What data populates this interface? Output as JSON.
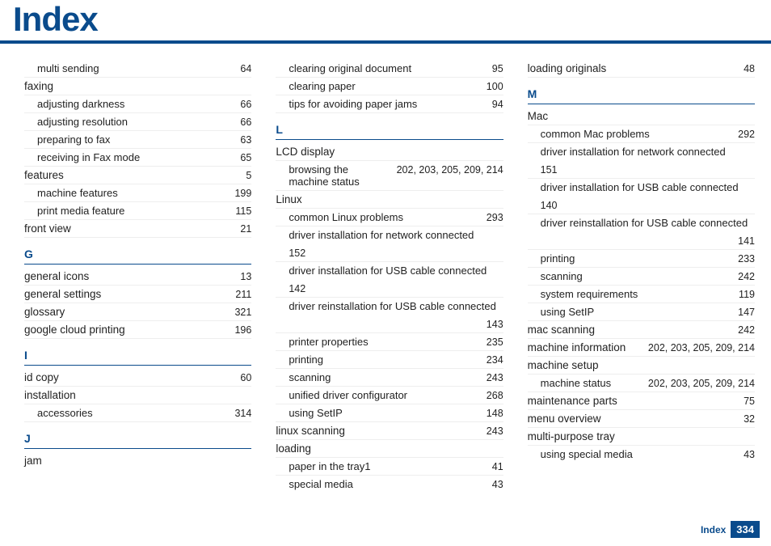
{
  "title": "Index",
  "footer": {
    "label": "Index",
    "page": "334"
  },
  "col1": [
    {
      "type": "sub",
      "label": "multi sending",
      "pages": "64"
    },
    {
      "type": "top",
      "label": "faxing",
      "pages": ""
    },
    {
      "type": "sub",
      "label": "adjusting darkness",
      "pages": "66"
    },
    {
      "type": "sub",
      "label": "adjusting resolution",
      "pages": "66"
    },
    {
      "type": "sub",
      "label": "preparing to fax",
      "pages": "63"
    },
    {
      "type": "sub",
      "label": "receiving in Fax mode",
      "pages": "65"
    },
    {
      "type": "top",
      "label": "features",
      "pages": "5"
    },
    {
      "type": "sub",
      "label": "machine features",
      "pages": "199"
    },
    {
      "type": "sub",
      "label": "print media feature",
      "pages": "115"
    },
    {
      "type": "top",
      "label": "front view",
      "pages": "21"
    },
    {
      "type": "letter",
      "label": "G"
    },
    {
      "type": "top",
      "label": "general icons",
      "pages": "13"
    },
    {
      "type": "top",
      "label": "general settings",
      "pages": "211"
    },
    {
      "type": "top",
      "label": "glossary",
      "pages": "321"
    },
    {
      "type": "top",
      "label": "google cloud printing",
      "pages": "196"
    },
    {
      "type": "letter",
      "label": "I"
    },
    {
      "type": "top",
      "label": "id copy",
      "pages": "60"
    },
    {
      "type": "top",
      "label": "installation",
      "pages": ""
    },
    {
      "type": "sub",
      "label": "accessories",
      "pages": "314"
    },
    {
      "type": "letter",
      "label": "J"
    },
    {
      "type": "top",
      "label": "jam",
      "pages": "",
      "noborder": true
    }
  ],
  "col2": [
    {
      "type": "sub",
      "label": "clearing original document",
      "pages": "95"
    },
    {
      "type": "sub",
      "label": "clearing paper",
      "pages": "100"
    },
    {
      "type": "sub",
      "label": "tips for avoiding paper jams",
      "pages": "94"
    },
    {
      "type": "letter",
      "label": "L"
    },
    {
      "type": "top",
      "label": "LCD display",
      "pages": ""
    },
    {
      "type": "sub",
      "label": "browsing the machine status",
      "pages": "202, 203, 205, 209, 214",
      "wrapPagesRight": true
    },
    {
      "type": "top",
      "label": "Linux",
      "pages": ""
    },
    {
      "type": "sub",
      "label": "common Linux problems",
      "pages": "293"
    },
    {
      "type": "sub",
      "label": "driver installation for network connected",
      "pagesBelow": "152"
    },
    {
      "type": "sub",
      "label": "driver installation for USB cable connected",
      "pagesBelow": "142"
    },
    {
      "type": "sub",
      "label": "driver reinstallation for USB cable connected",
      "pagesBelow": "143",
      "pagesRight": true
    },
    {
      "type": "sub",
      "label": "printer properties",
      "pages": "235"
    },
    {
      "type": "sub",
      "label": "printing",
      "pages": "234"
    },
    {
      "type": "sub",
      "label": "scanning",
      "pages": "243"
    },
    {
      "type": "sub",
      "label": "unified driver configurator",
      "pages": "268"
    },
    {
      "type": "sub",
      "label": "using SetIP",
      "pages": "148"
    },
    {
      "type": "top",
      "label": "linux scanning",
      "pages": "243"
    },
    {
      "type": "top",
      "label": "loading",
      "pages": ""
    },
    {
      "type": "sub",
      "label": "paper in the tray1",
      "pages": "41"
    },
    {
      "type": "sub",
      "label": "special media",
      "pages": "43",
      "noborder": true
    }
  ],
  "col3": [
    {
      "type": "top",
      "label": "loading originals",
      "pages": "48"
    },
    {
      "type": "letter",
      "label": "M"
    },
    {
      "type": "top",
      "label": "Mac",
      "pages": ""
    },
    {
      "type": "sub",
      "label": "common Mac problems",
      "pages": "292"
    },
    {
      "type": "sub",
      "label": "driver installation for network connected",
      "pagesBelow": "151"
    },
    {
      "type": "sub",
      "label": "driver installation for USB cable connected",
      "pagesBelow": "140"
    },
    {
      "type": "sub",
      "label": "driver reinstallation for USB cable connected",
      "pagesBelow": "141",
      "pagesRight": true
    },
    {
      "type": "sub",
      "label": "printing",
      "pages": "233"
    },
    {
      "type": "sub",
      "label": "scanning",
      "pages": "242"
    },
    {
      "type": "sub",
      "label": "system requirements",
      "pages": "119"
    },
    {
      "type": "sub",
      "label": "using SetIP",
      "pages": "147"
    },
    {
      "type": "top",
      "label": "mac scanning",
      "pages": "242"
    },
    {
      "type": "top",
      "label": "machine information",
      "pages": "202, 203, 205, 209, 214"
    },
    {
      "type": "top",
      "label": "machine setup",
      "pages": ""
    },
    {
      "type": "sub",
      "label": "machine status",
      "pages": "202, 203, 205, 209, 214"
    },
    {
      "type": "top",
      "label": "maintenance parts",
      "pages": "75"
    },
    {
      "type": "top",
      "label": "menu overview",
      "pages": "32"
    },
    {
      "type": "top",
      "label": "multi-purpose tray",
      "pages": ""
    },
    {
      "type": "sub",
      "label": "using special media",
      "pages": "43",
      "noborder": true
    }
  ]
}
